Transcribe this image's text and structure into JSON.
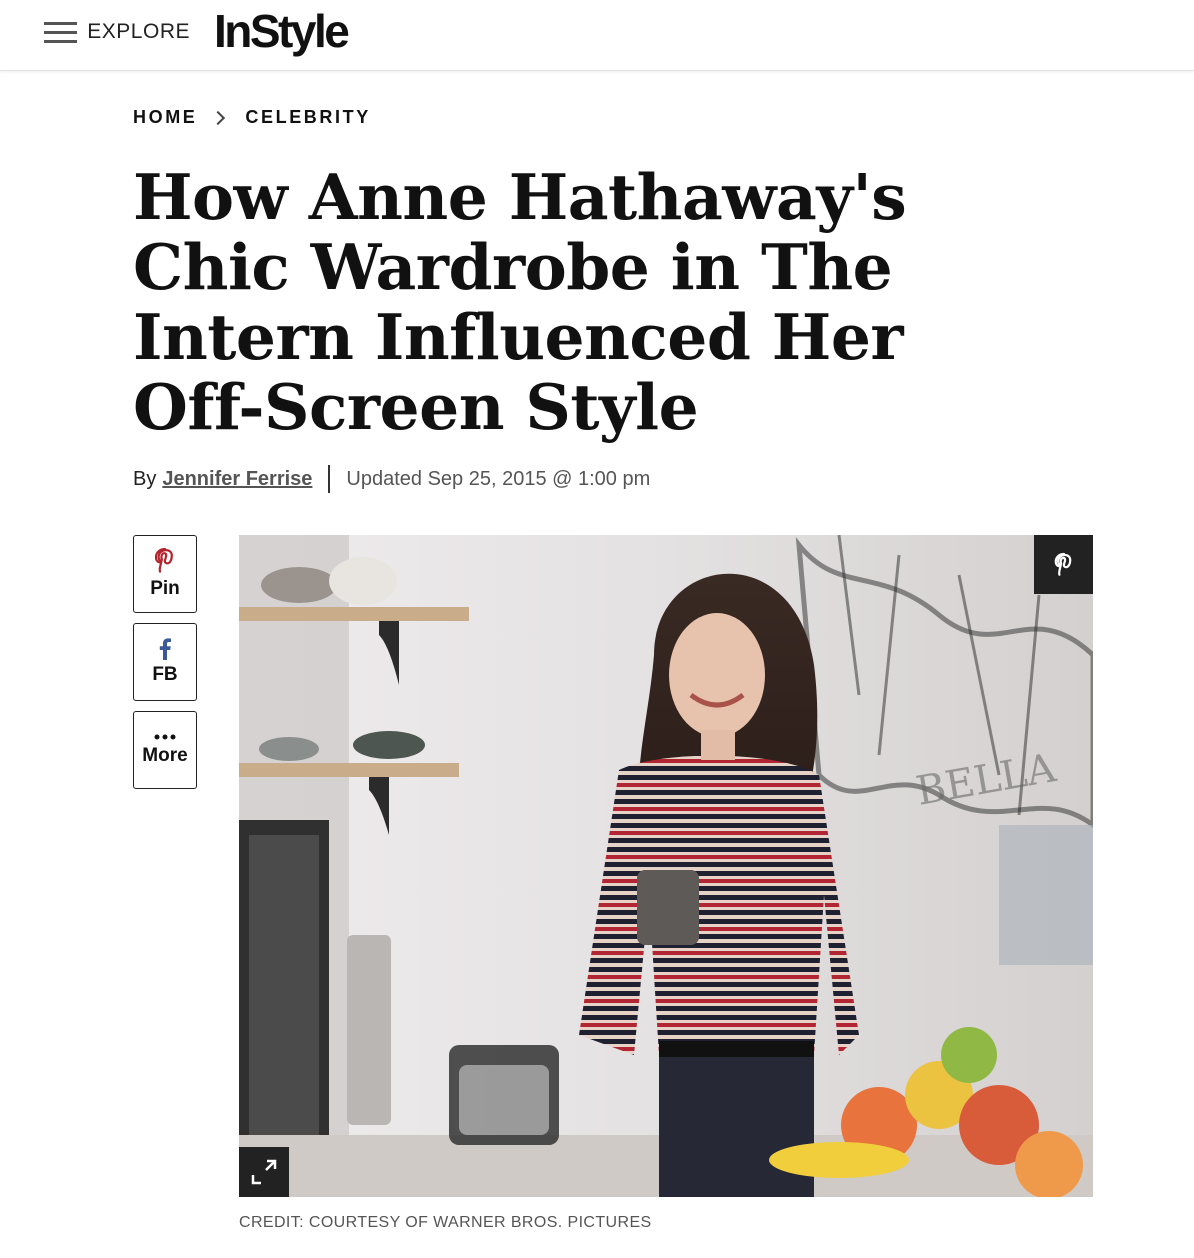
{
  "header": {
    "menu_label": "EXPLORE",
    "logo_text": "InStyle"
  },
  "breadcrumb": {
    "items": [
      "HOME",
      "CELEBRITY"
    ]
  },
  "article": {
    "title": "How Anne Hathaway's Chic Wardrobe in The Intern Influenced Her Off-Screen Style",
    "byline_prefix": "By",
    "author": "Jennifer Ferrise",
    "updated": "Updated Sep 25, 2015 @ 1:00 pm",
    "image_credit": "CREDIT: COURTESY OF WARNER BROS. PICTURES",
    "image_text": "BELLA"
  },
  "share": {
    "pin_label": "Pin",
    "fb_label": "FB",
    "more_label": "More"
  },
  "colors": {
    "pinterest": "#b3242c",
    "facebook": "#3b5998",
    "overlay": "#222222"
  }
}
